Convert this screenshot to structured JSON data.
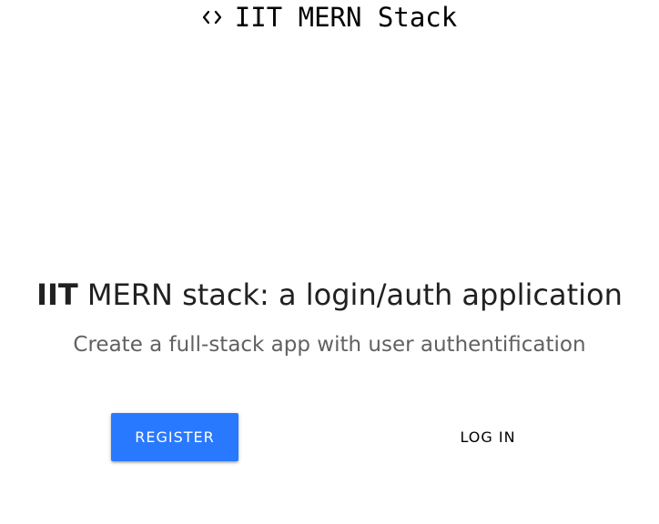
{
  "navbar": {
    "brand_icon": "code-icon",
    "brand_text": "IIT MERN Stack"
  },
  "hero": {
    "headline_strong": "IIT",
    "headline_rest": " MERN stack: a login/auth application",
    "subline": "Create a full-stack app with user authentification"
  },
  "actions": {
    "register_label": "Register",
    "login_label": "Log In"
  },
  "colors": {
    "accent": "#2979ff",
    "text_primary": "#212121",
    "text_secondary": "#616161"
  }
}
